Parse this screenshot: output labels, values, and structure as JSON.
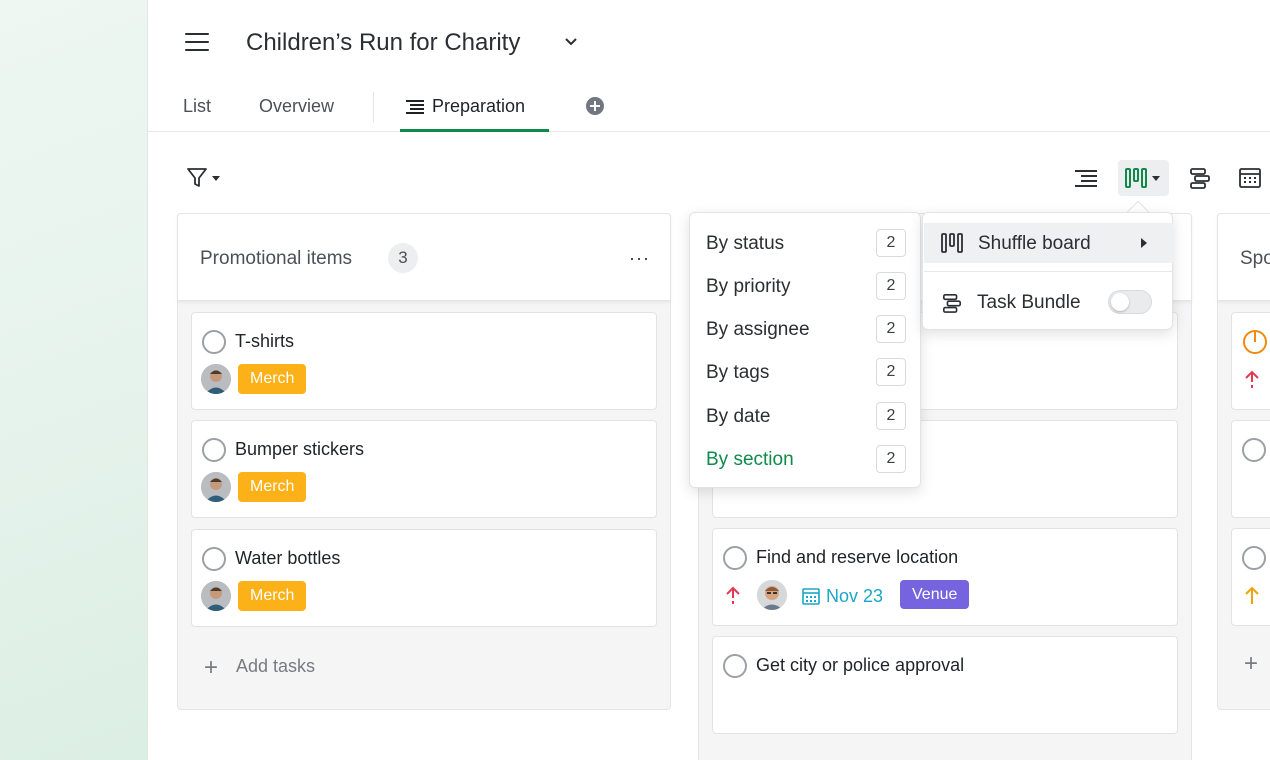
{
  "header": {
    "project_title": "Children’s Run for Charity"
  },
  "tabs": [
    {
      "label": "List"
    },
    {
      "label": "Overview"
    },
    {
      "label": "Preparation"
    }
  ],
  "columns": [
    {
      "title": "Promotional items",
      "count": "3",
      "more": "···",
      "add_label": "Add tasks",
      "cards": [
        {
          "title": "T-shirts",
          "tag": "Merch"
        },
        {
          "title": "Bumper stickers",
          "tag": "Merch"
        },
        {
          "title": "Water bottles",
          "tag": "Merch"
        }
      ]
    },
    {
      "title": "",
      "cards": [
        {
          "title": ""
        },
        {
          "title": ""
        },
        {
          "title": "Find and reserve location",
          "date": "Nov 23",
          "tag": "Venue"
        },
        {
          "title": "Get city or police approval"
        }
      ]
    },
    {
      "title": "Spo"
    }
  ],
  "group_menu": {
    "items": [
      {
        "label": "By status",
        "count": "2"
      },
      {
        "label": "By priority",
        "count": "2"
      },
      {
        "label": "By assignee",
        "count": "2"
      },
      {
        "label": "By tags",
        "count": "2"
      },
      {
        "label": "By date",
        "count": "2"
      },
      {
        "label": "By section",
        "count": "2",
        "active": true
      }
    ]
  },
  "view_menu": {
    "shuffle_board": "Shuffle board",
    "task_bundle": "Task Bundle",
    "task_bundle_enabled": false
  },
  "colors": {
    "accent": "#0f8a4a",
    "merch_tag": "#fbb117",
    "venue_tag": "#7663e0",
    "date": "#19a7c7",
    "priority_high": "#e5374f",
    "priority_medium": "#f0a20e"
  }
}
